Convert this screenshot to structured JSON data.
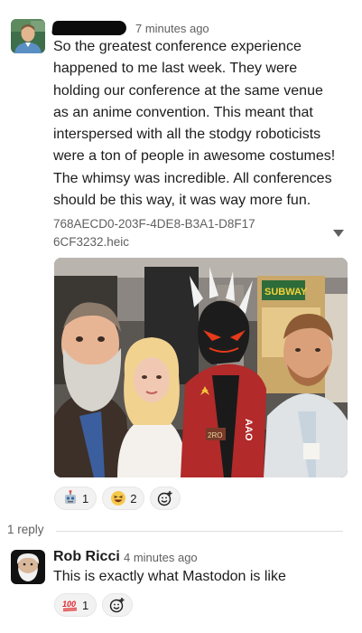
{
  "message": {
    "author_redacted": true,
    "timestamp": "7 minutes ago",
    "text": "So the greatest conference experience happened to me last week. They were holding our conference at the same venue as an anime convention. This meant that interspersed with all the stodgy roboticists were a ton of people in awesome costumes! The whimsy was incredible. All conferences should be this way, it was way more fun.",
    "attachment": {
      "file_name": "768AECD0-203F-4DE8-B3A1-D8F176CF3232.heic",
      "sign_text": "SUBWAY",
      "chest_text": "AAO",
      "tag_text": "2RO"
    },
    "reactions": [
      {
        "icon": "robot-emoji",
        "count": "1"
      },
      {
        "icon": "laughing-emoji",
        "count": "2"
      }
    ]
  },
  "thread": {
    "reply_count_label": "1 reply"
  },
  "reply": {
    "author": "Rob Ricci",
    "timestamp": "4 minutes ago",
    "text": "This is exactly what Mastodon is like",
    "reactions": [
      {
        "icon": "hundred-emoji",
        "count": "1"
      }
    ]
  },
  "colors": {
    "text": "#1d1c1d",
    "muted": "#616061",
    "reaction_bg": "#f2f2f2"
  }
}
